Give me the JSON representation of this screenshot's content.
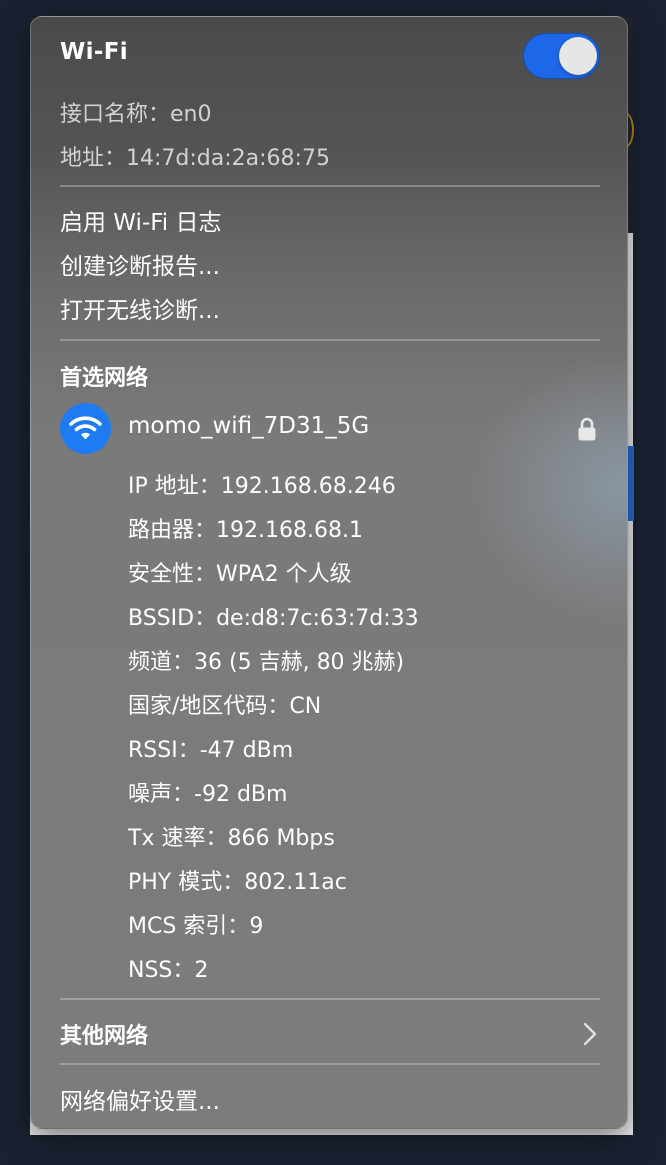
{
  "wifi": {
    "title": "Wi-Fi",
    "enabled": true,
    "accent_color": "#1d68e8"
  },
  "interface": {
    "name_label": "接口名称：",
    "name_value": "en0",
    "address_label": "地址：",
    "address_value": "14:7d:da:2a:68:75"
  },
  "actions": [
    {
      "label": "启用 Wi-Fi 日志"
    },
    {
      "label": "创建诊断报告..."
    },
    {
      "label": "打开无线诊断..."
    }
  ],
  "preferred": {
    "heading": "首选网络",
    "network_name": "momo_wifi_7D31_5G",
    "icon": "wifi-icon",
    "secured_icon": "lock-icon",
    "details": [
      {
        "label": "IP 地址：",
        "value": "192.168.68.246"
      },
      {
        "label": "路由器：",
        "value": "192.168.68.1"
      },
      {
        "label": "安全性：",
        "value": "WPA2 个人级"
      },
      {
        "label": "BSSID：",
        "value": "de:d8:7c:63:7d:33"
      },
      {
        "label": "频道：",
        "value": "36 (5 吉赫, 80 兆赫)"
      },
      {
        "label": "国家/地区代码：",
        "value": "CN"
      },
      {
        "label": "RSSI：",
        "value": "-47 dBm"
      },
      {
        "label": "噪声：",
        "value": "-92 dBm"
      },
      {
        "label": "Tx 速率：",
        "value": "866 Mbps"
      },
      {
        "label": "PHY 模式：",
        "value": "802.11ac"
      },
      {
        "label": "MCS 索引：",
        "value": "9"
      },
      {
        "label": "NSS：",
        "value": "2"
      }
    ]
  },
  "other_networks": {
    "label": "其他网络",
    "icon": "chevron-right-icon"
  },
  "preferences": {
    "label": "网络偏好设置..."
  }
}
